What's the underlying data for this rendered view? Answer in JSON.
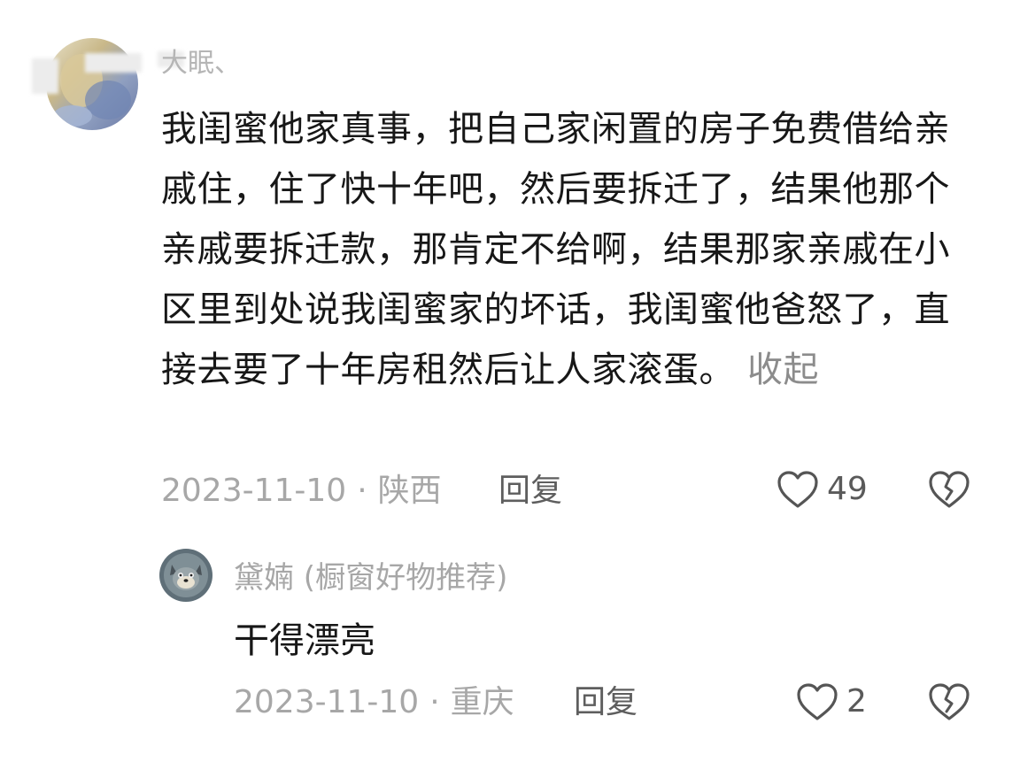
{
  "comment": {
    "username": "大眠、",
    "text": "我闺蜜他家真事，把自己家闲置的房子免费借给亲戚住，住了快十年吧，然后要拆迁了，结果他那个亲戚要拆迁款，那肯定不给啊，结果那家亲戚在小区里到处说我闺蜜家的坏话，我闺蜜他爸怒了，直接去要了十年房租然后让人家滚蛋。",
    "collapse_label": "收起",
    "date": "2023-11-10",
    "separator": "·",
    "location": "陕西",
    "reply_label": "回复",
    "likes": "49"
  },
  "reply": {
    "username": "黛婻 (橱窗好物推荐)",
    "text": "干得漂亮",
    "date": "2023-11-10",
    "separator": "·",
    "location": "重庆",
    "reply_label": "回复",
    "likes": "2"
  },
  "colors": {
    "text": "#171717",
    "muted": "#a7a7a7",
    "action": "#5e5e5e",
    "icon": "#555555"
  },
  "icons": {
    "like": "heart-outline-icon",
    "dislike": "broken-heart-icon"
  }
}
